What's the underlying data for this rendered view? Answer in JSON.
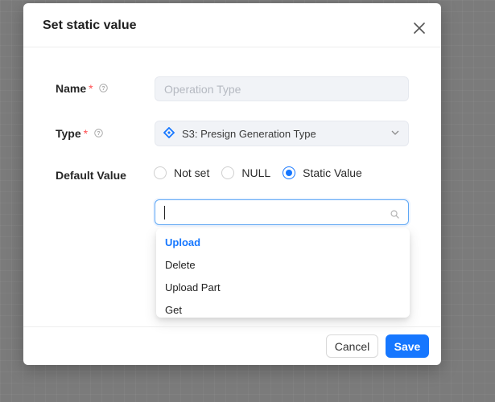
{
  "modal": {
    "title": "Set static value",
    "fields": {
      "name": {
        "label": "Name",
        "required": "*",
        "placeholder": "Operation Type"
      },
      "type": {
        "label": "Type",
        "required": "*",
        "value": "S3: Presign Generation Type"
      },
      "default_value": {
        "label": "Default Value",
        "options": [
          "Not set",
          "NULL",
          "Static Value"
        ],
        "selected": "Static Value"
      }
    },
    "search": {
      "value": ""
    },
    "dropdown": {
      "items": [
        "Upload",
        "Delete",
        "Upload Part",
        "Get"
      ],
      "active": "Upload"
    },
    "footer": {
      "cancel_label": "Cancel",
      "save_label": "Save"
    }
  },
  "colors": {
    "accent": "#1677ff",
    "required": "#ff4d4f",
    "overlay": "#7b7b7b"
  }
}
